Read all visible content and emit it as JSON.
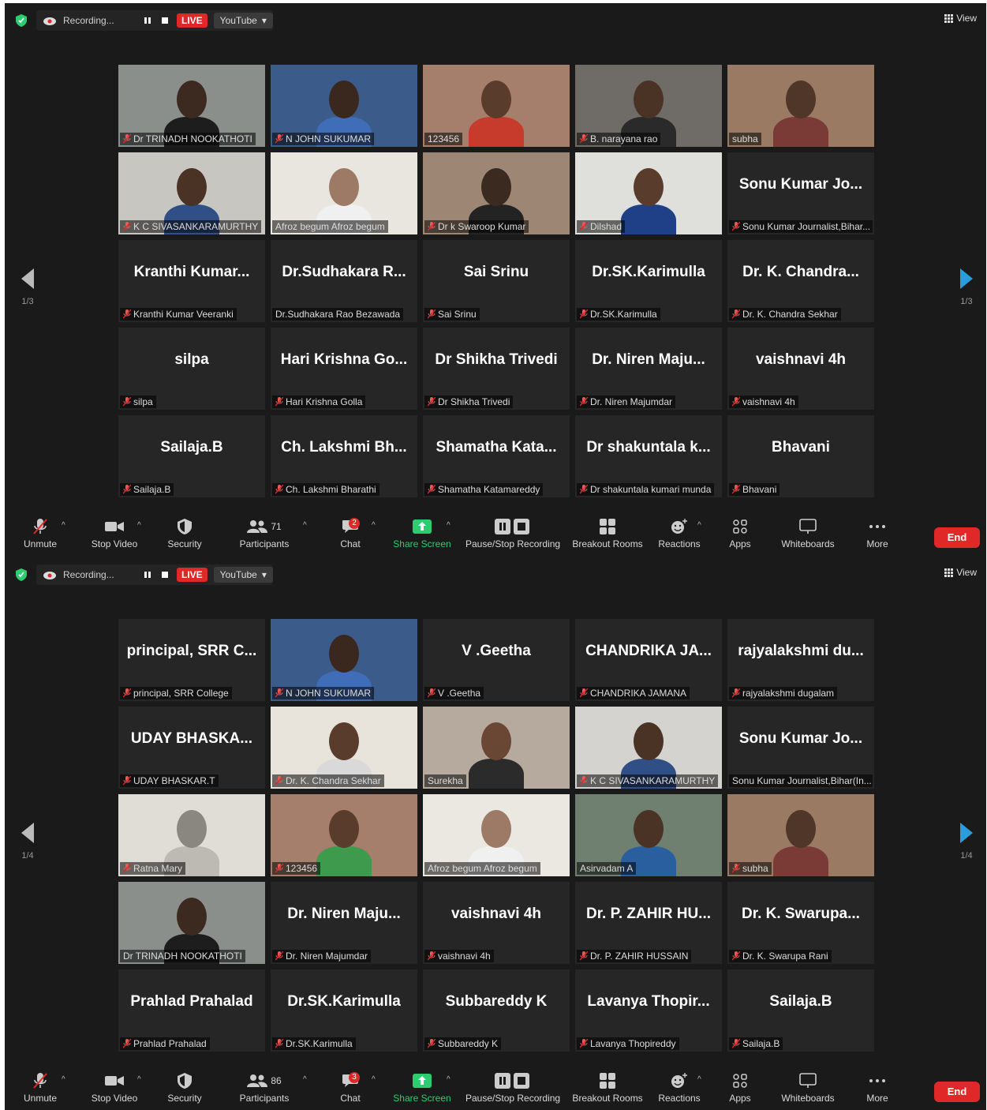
{
  "shots": [
    {
      "recording_label": "Recording...",
      "live_label": "LIVE",
      "youtube_label": "YouTube",
      "view_label": "View",
      "page_indicator": "1/3",
      "participants_count": "71",
      "chat_badge": "2",
      "tiles": [
        {
          "big": "",
          "label": "Dr TRINADH NOOKATHOTI",
          "muted": true,
          "video": {
            "bg": "#8a8f8c",
            "skin": "#3c2a20",
            "shirt": "#1d1d1d"
          }
        },
        {
          "big": "",
          "label": "N JOHN SUKUMAR",
          "muted": true,
          "video": {
            "bg": "#3b5c8a",
            "skin": "#3a281e",
            "shirt": "#3f6db8"
          }
        },
        {
          "big": "",
          "label": "123456",
          "muted": false,
          "highlight": true,
          "video": {
            "bg": "#a57f6c",
            "skin": "#5a3c2c",
            "shirt": "#c73b2d"
          }
        },
        {
          "big": "",
          "label": "B. narayana rao",
          "muted": true,
          "video": {
            "bg": "#6f6b66",
            "skin": "#4a3224",
            "shirt": "#2a2a2a"
          }
        },
        {
          "big": "",
          "label": "subha",
          "muted": false,
          "video": {
            "bg": "#9a7a62",
            "skin": "#4f3628",
            "shirt": "#7a3a36"
          }
        },
        {
          "big": "",
          "label": "K C SIVASANKARAMURTHY",
          "muted": true,
          "video": {
            "bg": "#c8c6c0",
            "skin": "#4a3224",
            "shirt": "#2f4f86"
          }
        },
        {
          "big": "",
          "label": "Afroz begum Afroz begum",
          "muted": false,
          "video": {
            "bg": "#e9e6e0",
            "skin": "#9c7a66",
            "shirt": "#f0f0f0"
          }
        },
        {
          "big": "",
          "label": "Dr k Swaroop Kumar",
          "muted": true,
          "video": {
            "bg": "#9d8774",
            "skin": "#3b2a20",
            "shirt": "#232323"
          }
        },
        {
          "big": "",
          "label": "Dilshad",
          "muted": true,
          "video": {
            "bg": "#dfe0dc",
            "skin": "#5a3c2c",
            "shirt": "#1f3f86"
          }
        },
        {
          "big": "Sonu Kumar Jo...",
          "label": "Sonu Kumar Journalist,Bihar...",
          "muted": true
        },
        {
          "big": "Kranthi Kumar...",
          "label": "Kranthi Kumar Veeranki",
          "muted": true
        },
        {
          "big": "Dr.Sudhakara R...",
          "label": "Dr.Sudhakara Rao Bezawada",
          "muted": false
        },
        {
          "big": "Sai Srinu",
          "label": "Sai Srinu",
          "muted": true
        },
        {
          "big": "Dr.SK.Karimulla",
          "label": "Dr.SK.Karimulla",
          "muted": true
        },
        {
          "big": "Dr. K. Chandra...",
          "label": "Dr. K. Chandra Sekhar",
          "muted": true
        },
        {
          "big": "silpa",
          "label": "silpa",
          "muted": true
        },
        {
          "big": "Hari Krishna Go...",
          "label": "Hari Krishna Golla",
          "muted": true
        },
        {
          "big": "Dr Shikha Trivedi",
          "label": "Dr Shikha Trivedi",
          "muted": true
        },
        {
          "big": "Dr. Niren Maju...",
          "label": "Dr. Niren Majumdar",
          "muted": true
        },
        {
          "big": "vaishnavi 4h",
          "label": "vaishnavi 4h",
          "muted": true
        },
        {
          "big": "Sailaja.B",
          "label": "Sailaja.B",
          "muted": true
        },
        {
          "big": "Ch. Lakshmi Bh...",
          "label": "Ch. Lakshmi Bharathi",
          "muted": true
        },
        {
          "big": "Shamatha Kata...",
          "label": "Shamatha Katamareddy",
          "muted": true
        },
        {
          "big": "Dr shakuntala k...",
          "label": "Dr shakuntala kumari munda",
          "muted": true
        },
        {
          "big": "Bhavani",
          "label": "Bhavani",
          "muted": true
        }
      ]
    },
    {
      "recording_label": "Recording...",
      "live_label": "LIVE",
      "youtube_label": "YouTube",
      "view_label": "View",
      "page_indicator": "1/4",
      "participants_count": "86",
      "chat_badge": "3",
      "tiles": [
        {
          "big": "principal, SRR C...",
          "label": "principal, SRR College",
          "muted": true
        },
        {
          "big": "",
          "label": "N JOHN SUKUMAR",
          "muted": true,
          "video": {
            "bg": "#3b5c8a",
            "skin": "#3a281e",
            "shirt": "#3f6db8"
          }
        },
        {
          "big": "V .Geetha",
          "label": "V .Geetha",
          "muted": true
        },
        {
          "big": "CHANDRIKA JA...",
          "label": "CHANDRIKA JAMANA",
          "muted": true
        },
        {
          "big": "rajyalakshmi du...",
          "label": "rajyalakshmi dugalam",
          "muted": true
        },
        {
          "big": "UDAY BHASKA...",
          "label": "UDAY BHASKAR.T",
          "muted": true
        },
        {
          "big": "",
          "label": "Dr. K. Chandra Sekhar",
          "muted": true,
          "video": {
            "bg": "#e8e4dc",
            "skin": "#5a3c2c",
            "shirt": "#d9d9d9"
          }
        },
        {
          "big": "",
          "label": "Surekha",
          "muted": false,
          "video": {
            "bg": "#b6a99e",
            "skin": "#6a4634",
            "shirt": "#2b2b2b"
          }
        },
        {
          "big": "",
          "label": "K C SIVASANKARAMURTHY",
          "muted": true,
          "video": {
            "bg": "#d5d3cf",
            "skin": "#4a3224",
            "shirt": "#2f4f86"
          }
        },
        {
          "big": "Sonu Kumar Jo...",
          "label": "Sonu Kumar Journalist,Bihar(In...",
          "muted": false
        },
        {
          "big": "",
          "label": "Ratna Mary",
          "muted": true,
          "video": {
            "bg": "#e0dcd6",
            "skin": "#8a8680",
            "shirt": "#bdbab4"
          }
        },
        {
          "big": "",
          "label": "123456",
          "muted": true,
          "video": {
            "bg": "#a57f6c",
            "skin": "#5a3c2c",
            "shirt": "#3e9a4d"
          }
        },
        {
          "big": "",
          "label": "Afroz begum Afroz begum",
          "muted": false,
          "video": {
            "bg": "#ebe8e2",
            "skin": "#9c7a66",
            "shirt": "#f0f0f0"
          }
        },
        {
          "big": "",
          "label": "Asirvadam A",
          "muted": false,
          "video": {
            "bg": "#6f7f70",
            "skin": "#4a3224",
            "shirt": "#2a5f9f"
          }
        },
        {
          "big": "",
          "label": "subha",
          "muted": true,
          "video": {
            "bg": "#9a7a62",
            "skin": "#4f3628",
            "shirt": "#7a3a36"
          }
        },
        {
          "big": "",
          "label": "Dr TRINADH NOOKATHOTI",
          "muted": false,
          "highlight": true,
          "video": {
            "bg": "#8a8f8c",
            "skin": "#3c2a20",
            "shirt": "#1d1d1d"
          }
        },
        {
          "big": "Dr. Niren Maju...",
          "label": "Dr. Niren Majumdar",
          "muted": true
        },
        {
          "big": "vaishnavi 4h",
          "label": "vaishnavi 4h",
          "muted": true
        },
        {
          "big": "Dr. P. ZAHIR HU...",
          "label": "Dr. P. ZAHIR HUSSAIN",
          "muted": true
        },
        {
          "big": "Dr. K. Swarupa...",
          "label": "Dr. K. Swarupa Rani",
          "muted": true
        },
        {
          "big": "Prahlad Prahalad",
          "label": "Prahlad Prahalad",
          "muted": true
        },
        {
          "big": "Dr.SK.Karimulla",
          "label": "Dr.SK.Karimulla",
          "muted": true
        },
        {
          "big": "Subbareddy K",
          "label": "Subbareddy K",
          "muted": true
        },
        {
          "big": "Lavanya Thopir...",
          "label": "Lavanya Thopireddy",
          "muted": true
        },
        {
          "big": "Sailaja.B",
          "label": "Sailaja.B",
          "muted": true
        }
      ]
    }
  ],
  "toolbar": {
    "unmute": "Unmute",
    "stop_video": "Stop Video",
    "security": "Security",
    "participants": "Participants",
    "chat": "Chat",
    "share_screen": "Share Screen",
    "pause_stop_recording": "Pause/Stop Recording",
    "breakout_rooms": "Breakout Rooms",
    "reactions": "Reactions",
    "apps": "Apps",
    "whiteboards": "Whiteboards",
    "more": "More",
    "end": "End"
  },
  "colors": {
    "accent_green": "#2ecc71",
    "live_red": "#e02828",
    "nav_blue": "#2d9cdb",
    "highlight_yellow": "#dfe07a",
    "background": "#1a1a1a",
    "tile": "#262626"
  }
}
